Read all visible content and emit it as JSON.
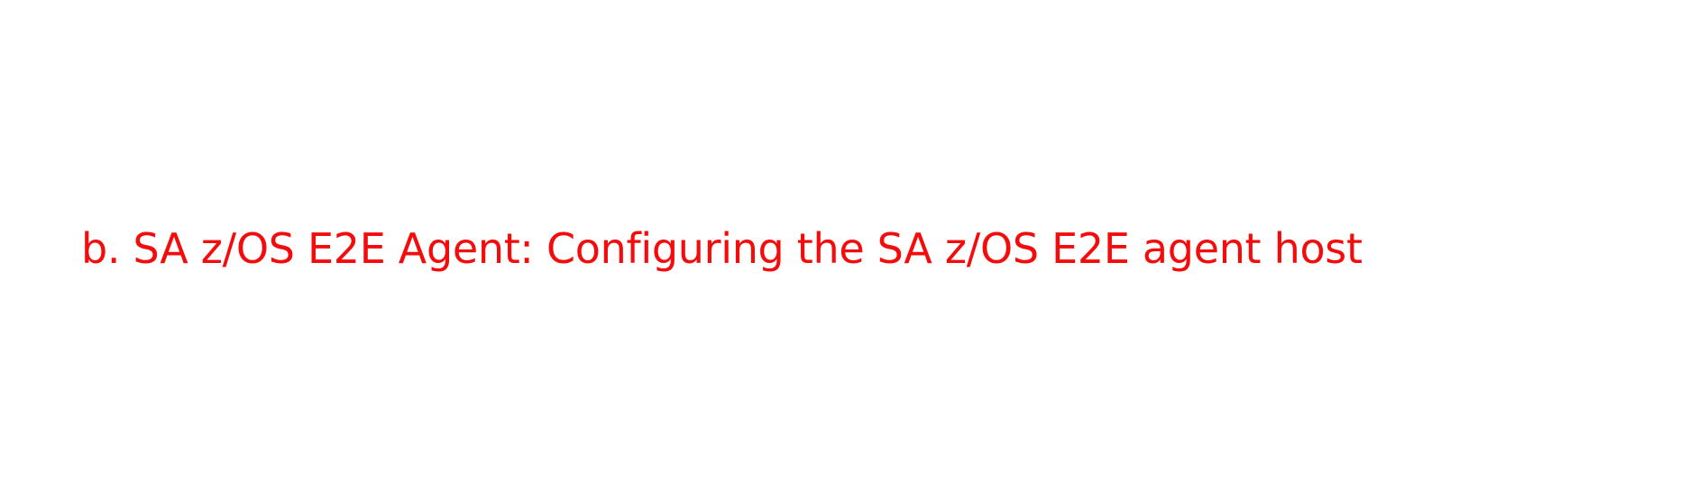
{
  "document": {
    "step_heading": "b. SA z/OS E2E Agent: Configuring the SA z/OS E2E agent host"
  },
  "colors": {
    "background": "#ffffff",
    "heading_text": "#f40b0b"
  }
}
